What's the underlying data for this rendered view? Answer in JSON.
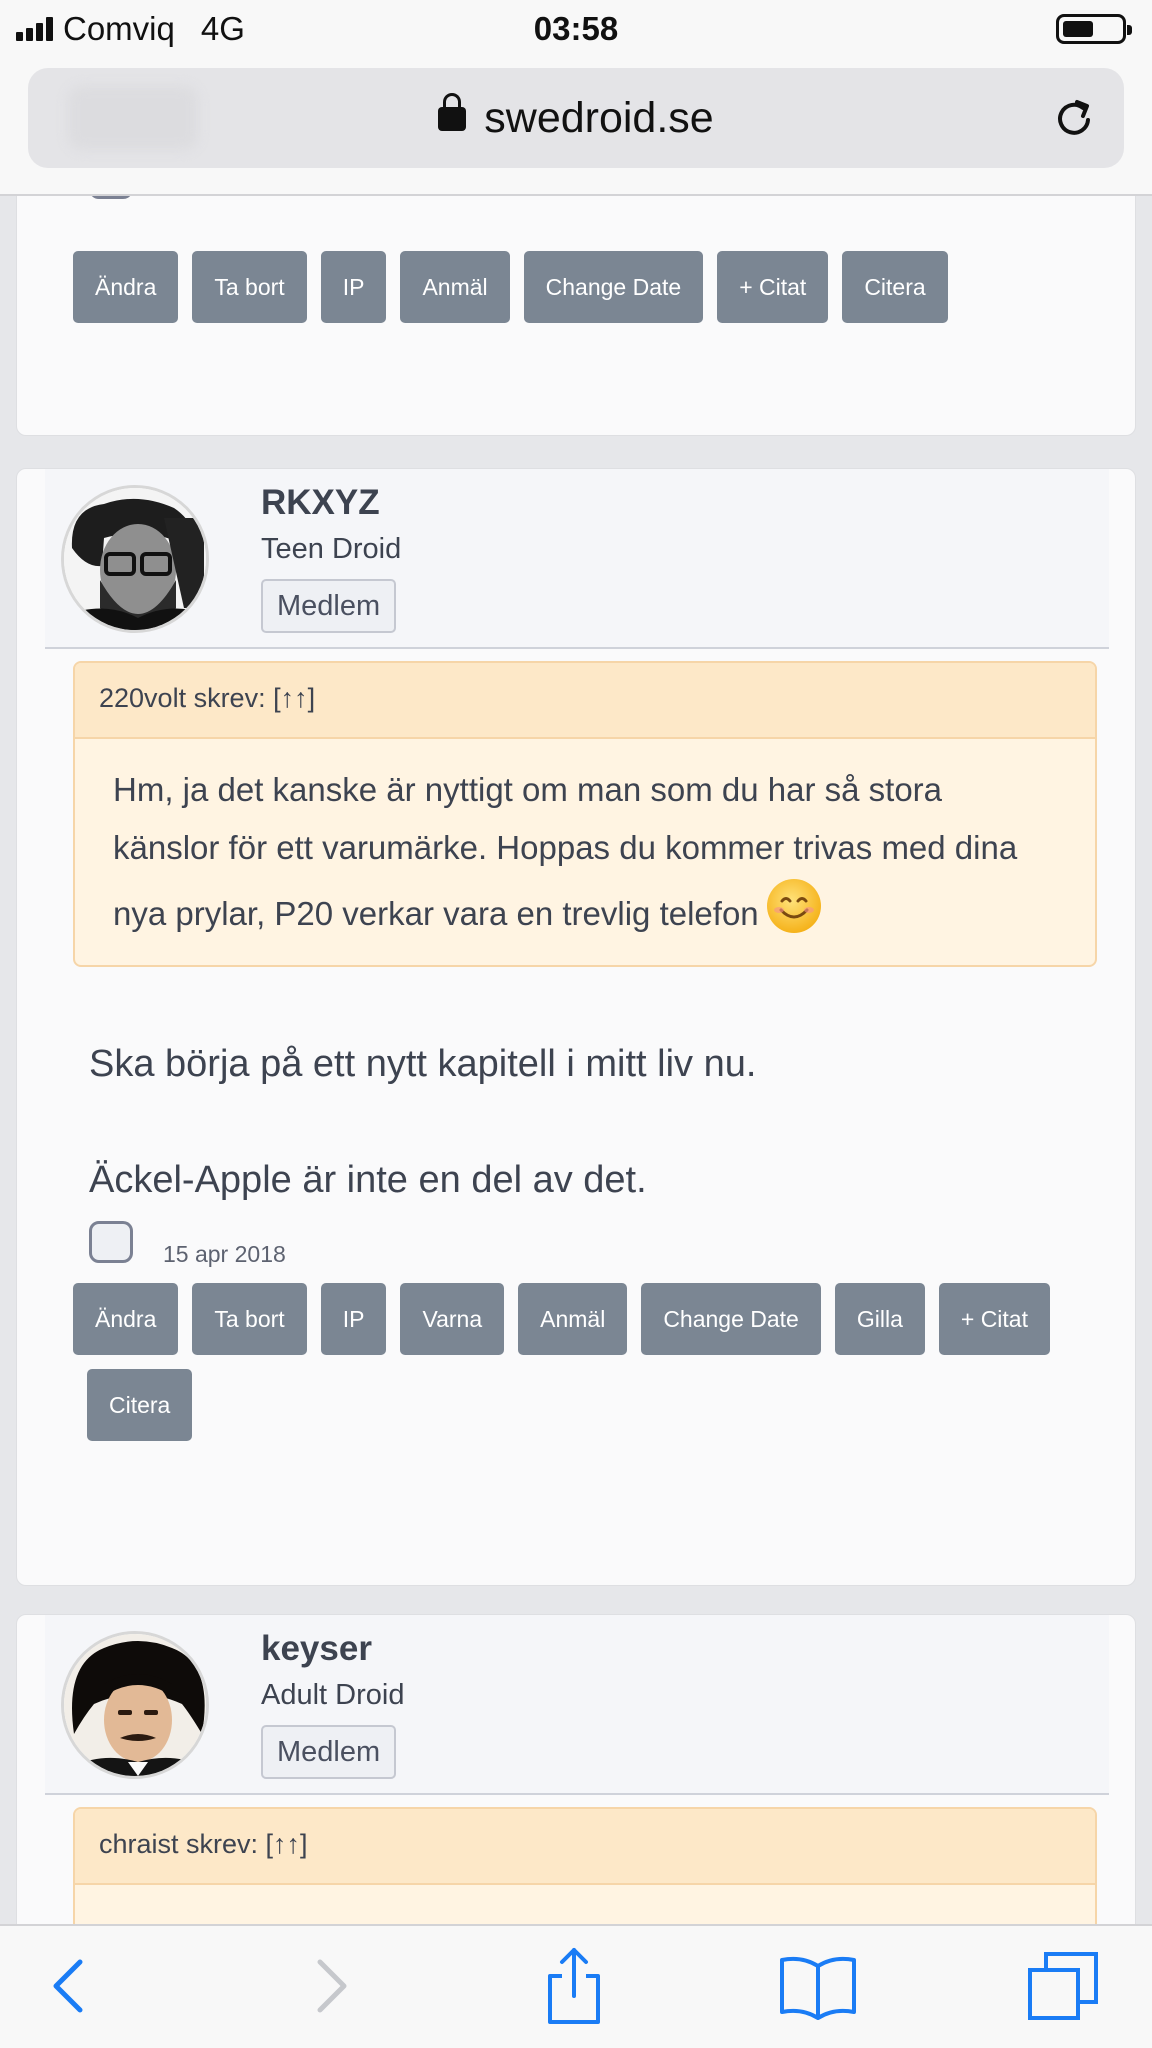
{
  "status": {
    "carrier": "Comviq",
    "network": "4G",
    "time": "03:58"
  },
  "url": {
    "domain": "swedroid.se"
  },
  "post_top": {
    "buttons": [
      "Ändra",
      "Ta bort",
      "IP",
      "Anmäl",
      "Change Date",
      "+ Citat",
      "Citera"
    ]
  },
  "post1": {
    "username": "RKXYZ",
    "rank": "Teen Droid",
    "badge": "Medlem",
    "quote_header": "220volt skrev: [↑↑]",
    "quote_text": "Hm, ja det kanske är nyttigt om man som du har så stora känslor för ett varumärke. Hoppas du kommer trivas med dina nya prylar, P20 verkar vara en trevlig telefon",
    "line1": "Ska börja på ett nytt kapitell i mitt liv nu.",
    "line2": "Äckel-Apple är inte en del av det.",
    "date": "15 apr 2018",
    "buttons": [
      "Ändra",
      "Ta bort",
      "IP",
      "Varna",
      "Anmäl",
      "Change Date",
      "Gilla",
      "+ Citat",
      "Citera"
    ]
  },
  "post2": {
    "username": "keyser",
    "rank": "Adult Droid",
    "badge": "Medlem",
    "quote_header": "chraist skrev: [↑↑]"
  },
  "icons": [
    "signal-icon",
    "battery-icon",
    "lock-icon",
    "reload-icon",
    "back-icon",
    "forward-icon",
    "share-icon",
    "bookmarks-icon",
    "tabs-icon",
    "smile-emoji-icon"
  ],
  "colors": {
    "button": "#7b8693",
    "quote_bg": "#fff4e2",
    "quote_header_bg": "#fde8c8",
    "quote_border": "#f6d5a8",
    "link_blue": "#1a7cf5"
  }
}
